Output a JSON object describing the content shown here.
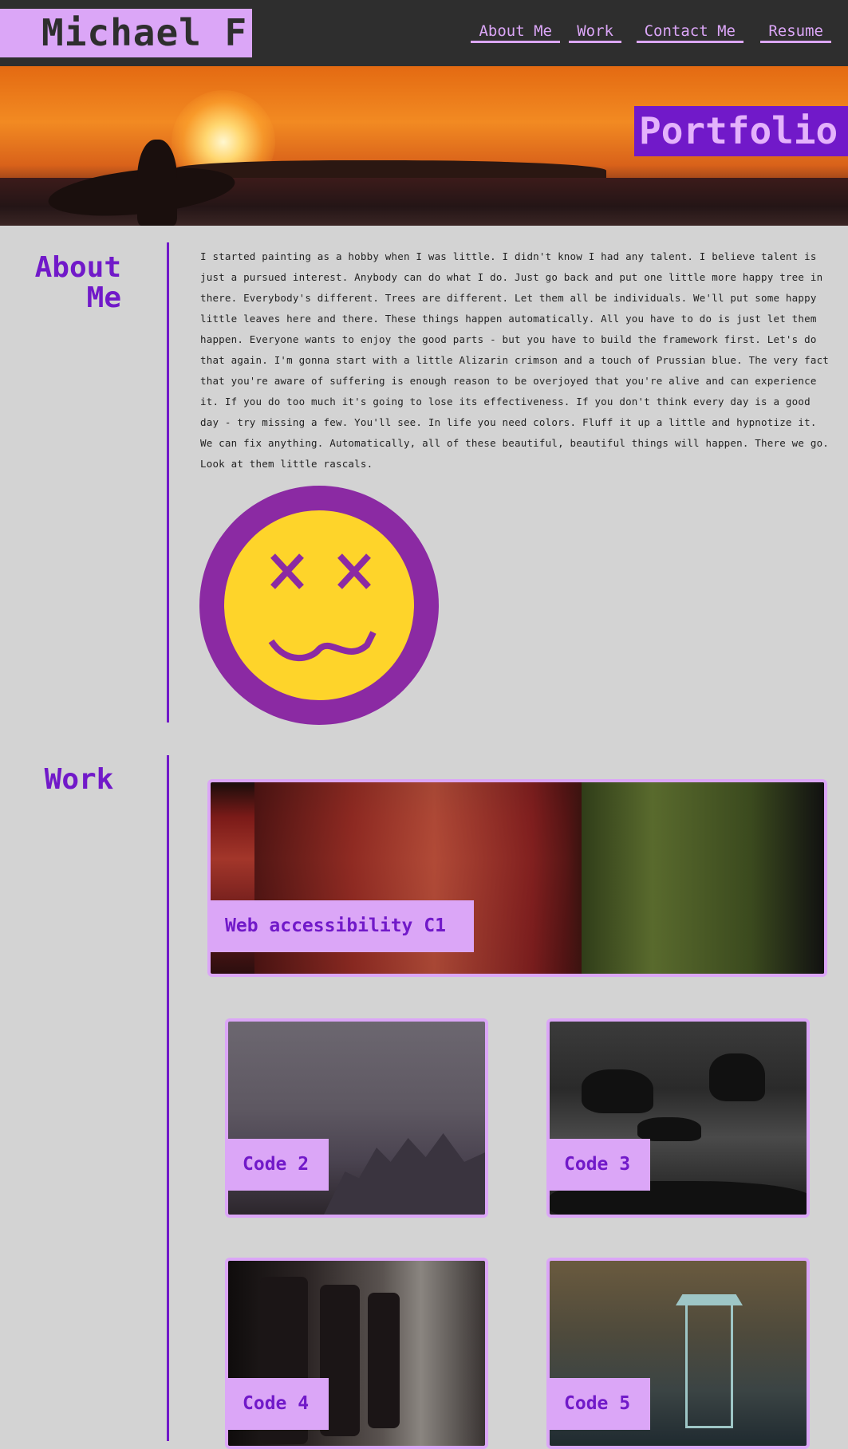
{
  "header": {
    "logo": "Michael F",
    "nav": [
      "About Me",
      "Work",
      "Contact Me",
      "Resume"
    ]
  },
  "hero": {
    "badge": "Portfolio"
  },
  "about": {
    "title_line1": "About",
    "title_line2": "Me",
    "body": "I started painting as a hobby when I was little. I didn't know I had any talent. I believe talent is just a pursued interest. Anybody can do what I do. Just go back and put one little more happy tree in there. Everybody's different. Trees are different. Let them all be individuals. We'll put some happy little leaves here and there. These things happen automatically. All you have to do is just let them happen. Everyone wants to enjoy the good parts - but you have to build the framework first. Let's do that again. I'm gonna start with a little Alizarin crimson and a touch of Prussian blue. The very fact that you're aware of suffering is enough reason to be overjoyed that you're alive and can experience it. If you do too much it's going to lose its effectiveness. If you don't think every day is a good day - try missing a few. You'll see. In life you need colors. Fluff it up a little and hypnotize it. We can fix anything. Automatically, all of these beautiful, beautiful things will happen. There we go. Look at them little rascals."
  },
  "work": {
    "title": "Work",
    "cards": [
      {
        "label": "Web accessibility C1"
      },
      {
        "label": "Code 2"
      },
      {
        "label": "Code 3"
      },
      {
        "label": "Code 4"
      },
      {
        "label": "Code 5"
      }
    ]
  },
  "colors": {
    "accent": "#7119c9",
    "accent_light": "#dba6f7",
    "header_bg": "#2e2e2e",
    "page_bg": "#d3d3d3",
    "smiley_ring": "#8b2aa3",
    "smiley_face": "#fed42a"
  },
  "icons": [
    "dizzy-face-icon"
  ]
}
